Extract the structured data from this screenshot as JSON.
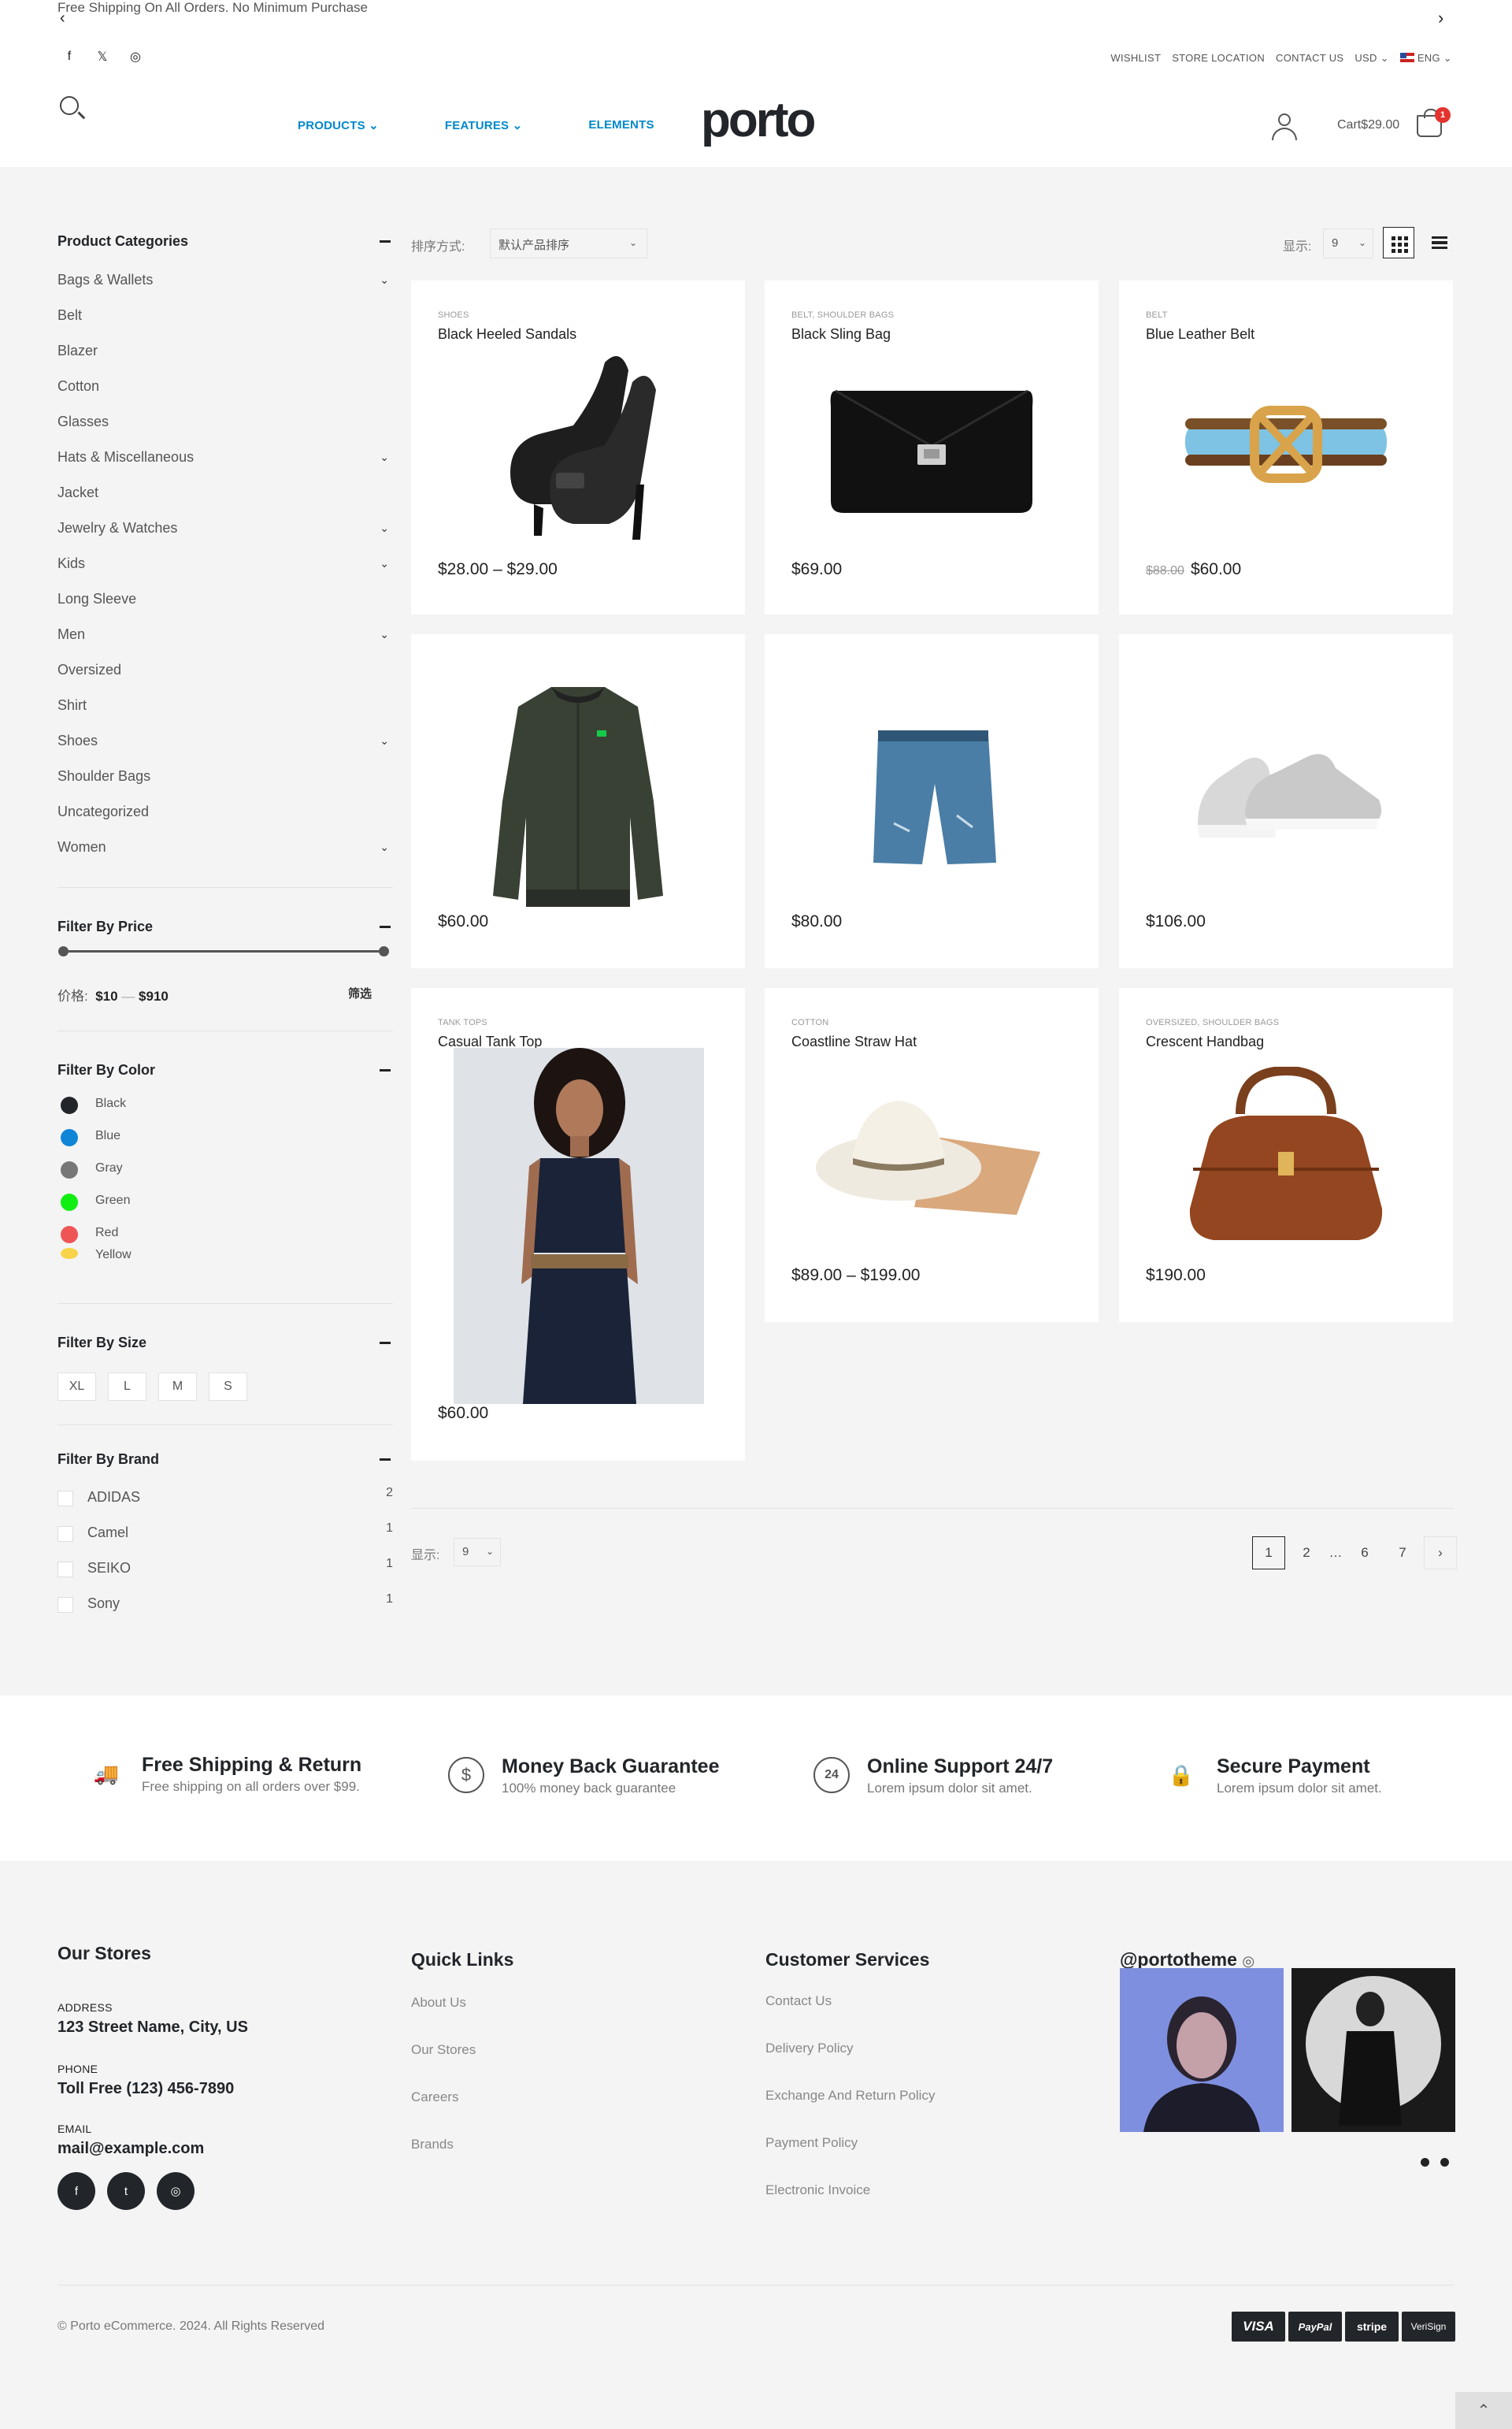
{
  "topbar": {
    "promo": "Free Shipping On All Orders. No Minimum Purchase",
    "prev_icon": "‹",
    "next_icon": "›"
  },
  "social_top": [
    {
      "icon": "f"
    },
    {
      "icon": "𝕏"
    },
    {
      "icon": "◎"
    }
  ],
  "toplinks": {
    "wishlist": "WISHLIST",
    "store_location": "STORE LOCATION",
    "contact_us": "CONTACT US",
    "currency": "USD ⌄",
    "language": "ENG ⌄"
  },
  "nav": {
    "products": "PRODUCTS ⌄",
    "features": "FEATURES ⌄",
    "elements": "ELEMENTS",
    "color": "#0088cc"
  },
  "logo": "porto",
  "cart": {
    "label": "Cart",
    "amount": "$29.00",
    "count": "1"
  },
  "sidebar": {
    "categories_title": "Product Categories",
    "categories": [
      {
        "label": "Bags & Wallets",
        "chev": "⌄"
      },
      {
        "label": "Belt",
        "chev": ""
      },
      {
        "label": "Blazer",
        "chev": ""
      },
      {
        "label": "Cotton",
        "chev": ""
      },
      {
        "label": "Glasses",
        "chev": ""
      },
      {
        "label": "Hats & Miscellaneous",
        "chev": "⌄"
      },
      {
        "label": "Jacket",
        "chev": ""
      },
      {
        "label": "Jewelry & Watches",
        "chev": "⌄"
      },
      {
        "label": "Kids",
        "chev": "⌄"
      },
      {
        "label": "Long Sleeve",
        "chev": ""
      },
      {
        "label": "Men",
        "chev": "⌄"
      },
      {
        "label": "Oversized",
        "chev": ""
      },
      {
        "label": "Shirt",
        "chev": ""
      },
      {
        "label": "Shoes",
        "chev": "⌄"
      },
      {
        "label": "Shoulder Bags",
        "chev": ""
      },
      {
        "label": "Uncategorized",
        "chev": ""
      },
      {
        "label": "Women",
        "chev": "⌄"
      }
    ],
    "price_title": "Filter By Price",
    "price_label": "价格:",
    "price_min": "$10",
    "price_sep": "—",
    "price_max": "$910",
    "filter_button": "筛选",
    "color_title": "Filter By Color",
    "colors": [
      {
        "label": "Black",
        "hex": "#222529"
      },
      {
        "label": "Blue",
        "hex": "#0f85d8"
      },
      {
        "label": "Gray",
        "hex": "#777777"
      },
      {
        "label": "Green",
        "hex": "#11ee11"
      },
      {
        "label": "Red",
        "hex": "#f05555"
      },
      {
        "label": "Yellow",
        "hex": "#f7d44a"
      }
    ],
    "size_title": "Filter By Size",
    "sizes": [
      "XL",
      "L",
      "M",
      "S"
    ],
    "brand_title": "Filter By Brand",
    "brands": [
      {
        "label": "ADIDAS",
        "count": "2"
      },
      {
        "label": "Camel",
        "count": "1"
      },
      {
        "label": "SEIKO",
        "count": "1"
      },
      {
        "label": "Sony",
        "count": "1"
      }
    ]
  },
  "toolbar": {
    "sort_label": "排序方式:",
    "sort_value": "默认产品排序",
    "show_label": "显示:",
    "show_value": "9"
  },
  "products": [
    {
      "cats": "SHOES",
      "name": "Black Heeled Sandals",
      "old_price": "",
      "price": "$28.00 – $29.00"
    },
    {
      "cats": "BELT, SHOULDER BAGS",
      "name": "Black Sling Bag",
      "old_price": "",
      "price": "$69.00"
    },
    {
      "cats": "BELT",
      "name": "Blue Leather Belt",
      "old_price": "$88.00",
      "price": "$60.00"
    },
    {
      "cats": "",
      "name": "",
      "old_price": "",
      "price": "$60.00"
    },
    {
      "cats": "",
      "name": "",
      "old_price": "",
      "price": "$80.00"
    },
    {
      "cats": "",
      "name": "",
      "old_price": "",
      "price": "$106.00"
    },
    {
      "cats": "TANK TOPS",
      "name": "Casual Tank Top",
      "old_price": "",
      "price": "$60.00"
    },
    {
      "cats": "COTTON",
      "name": "Coastline Straw Hat",
      "old_price": "",
      "price": "$89.00 – $199.00"
    },
    {
      "cats": "OVERSIZED, SHOULDER BAGS",
      "name": "Crescent Handbag",
      "old_price": "",
      "price": "$190.00"
    }
  ],
  "pagination": {
    "show_label": "显示:",
    "show_value": "9",
    "pages": [
      "1",
      "2",
      "…",
      "6",
      "7"
    ],
    "next": "›"
  },
  "features": [
    {
      "icon": "🚚",
      "title": "Free Shipping & Return",
      "desc": "Free shipping on all orders over $99."
    },
    {
      "icon": "$",
      "title": "Money Back Guarantee",
      "desc": "100% money back guarantee"
    },
    {
      "icon": "24",
      "title": "Online Support 24/7",
      "desc": "Lorem ipsum dolor sit amet."
    },
    {
      "icon": "🔒",
      "title": "Secure Payment",
      "desc": "Lorem ipsum dolor sit amet."
    }
  ],
  "footer": {
    "stores_title": "Our Stores",
    "address_label": "ADDRESS",
    "address": "123 Street Name, City, US",
    "phone_label": "PHONE",
    "phone": "Toll Free (123) 456-7890",
    "email_label": "EMAIL",
    "email": "mail@example.com",
    "social": [
      {
        "icon": "f"
      },
      {
        "icon": "t"
      },
      {
        "icon": "◎"
      }
    ],
    "quick_title": "Quick Links",
    "quick_links": [
      "About Us",
      "Our Stores",
      "Careers",
      "Brands"
    ],
    "service_title": "Customer Services",
    "service_links": [
      "Contact Us",
      "Delivery Policy",
      "Exchange And Return Policy",
      "Payment Policy",
      "Electronic Invoice"
    ],
    "insta_title": "@portotheme",
    "copyright": "© Porto eCommerce. 2024. All Rights Reserved",
    "payments": [
      "VISA",
      "PayPal",
      "stripe",
      "VeriSign"
    ]
  }
}
